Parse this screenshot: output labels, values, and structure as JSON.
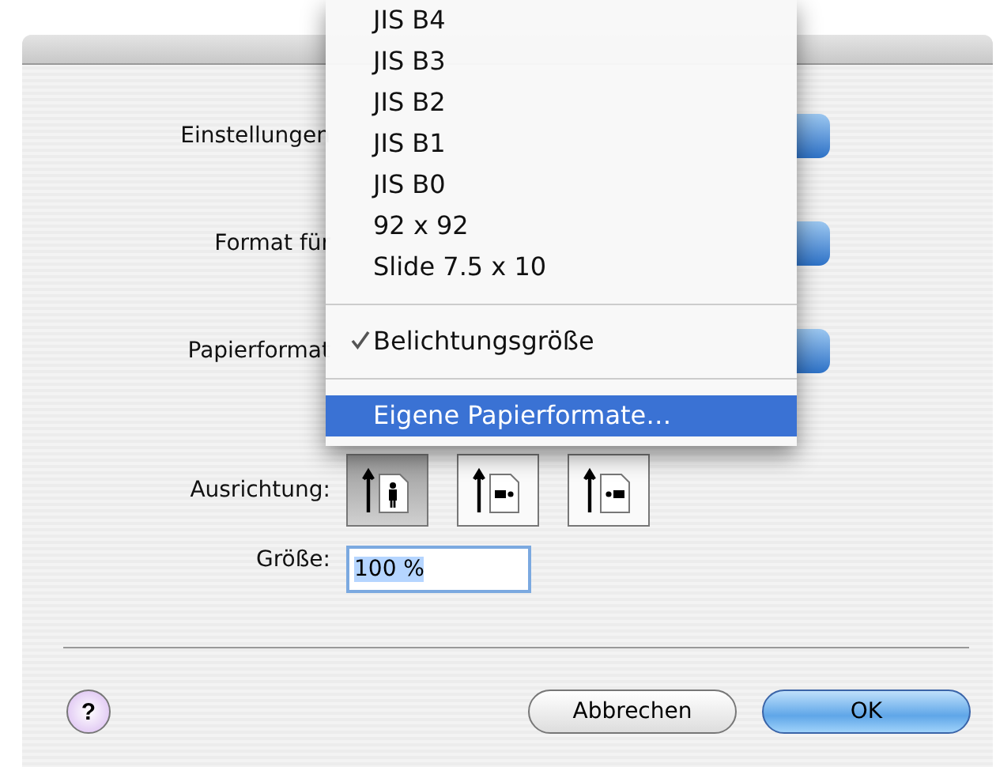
{
  "dialog": {
    "rows": [
      {
        "kind": "popup",
        "label": "Einstellungen"
      },
      {
        "kind": "popup",
        "label": "Format für"
      },
      {
        "kind": "popup",
        "label": "Papierformat"
      }
    ],
    "orientation": {
      "label": "Ausrichtung:",
      "options": [
        {
          "kind": "portrait",
          "selected": true
        },
        {
          "kind": "landscape",
          "selected": false
        },
        {
          "kind": "landscape-reverse",
          "selected": false
        }
      ]
    },
    "scale": {
      "label": "Größe:",
      "value": "100 %"
    },
    "help": {
      "label": "?"
    },
    "buttons": [
      {
        "label": "Abbrechen",
        "kind": "cancel"
      },
      {
        "label": "OK",
        "kind": "default"
      }
    ]
  },
  "menu": {
    "items": [
      {
        "kind": "item",
        "label": "JIS B4",
        "checked": false,
        "selected": false
      },
      {
        "kind": "item",
        "label": "JIS B3",
        "checked": false,
        "selected": false
      },
      {
        "kind": "item",
        "label": "JIS B2",
        "checked": false,
        "selected": false
      },
      {
        "kind": "item",
        "label": "JIS B1",
        "checked": false,
        "selected": false
      },
      {
        "kind": "item",
        "label": "JIS B0",
        "checked": false,
        "selected": false
      },
      {
        "kind": "item",
        "label": "92 x 92",
        "checked": false,
        "selected": false
      },
      {
        "kind": "item",
        "label": "Slide 7.5 x 10",
        "checked": false,
        "selected": false
      },
      {
        "kind": "separator"
      },
      {
        "kind": "item",
        "label": "Belichtungsgröße",
        "checked": true,
        "selected": false
      },
      {
        "kind": "separator"
      },
      {
        "kind": "item",
        "label": "Eigene Papierformate…",
        "checked": false,
        "selected": true
      }
    ]
  }
}
